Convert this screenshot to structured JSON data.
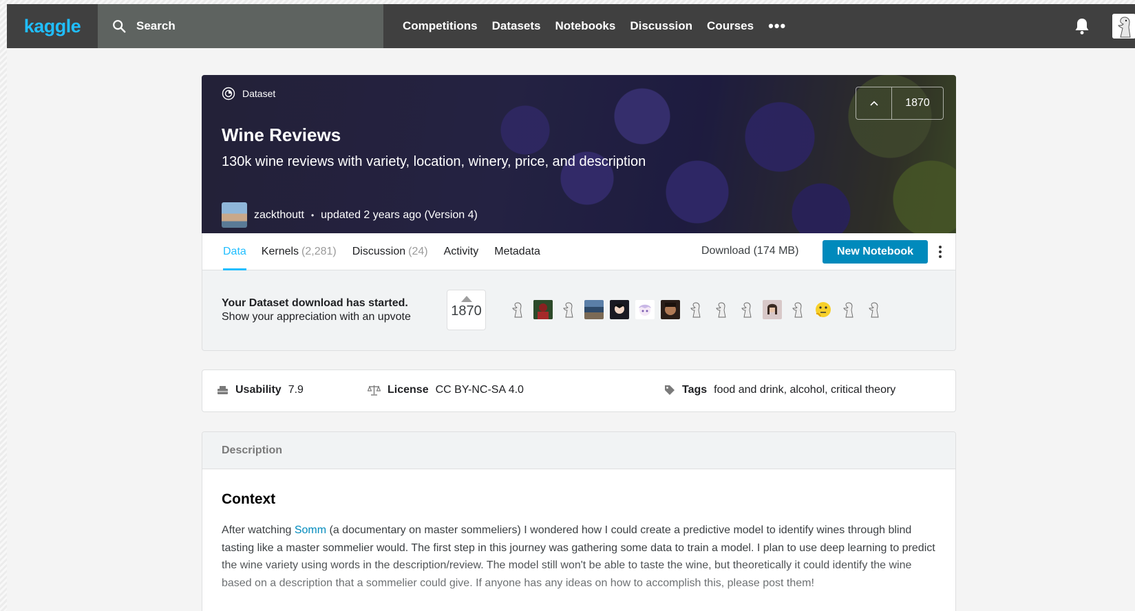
{
  "nav": {
    "logo": "kaggle",
    "search_label": "Search",
    "items": [
      "Competitions",
      "Datasets",
      "Notebooks",
      "Discussion",
      "Courses"
    ],
    "more": "•••"
  },
  "hero": {
    "type_label": "Dataset",
    "title": "Wine Reviews",
    "subtitle": "130k wine reviews with variety, location, winery, price, and description",
    "owner": "zackthoutt",
    "separator": "•",
    "updated": "updated 2 years ago (Version 4)",
    "votes": "1870"
  },
  "tabs": {
    "data": "Data",
    "kernels": "Kernels",
    "kernels_count": "(2,281)",
    "discussion": "Discussion",
    "discussion_count": "(24)",
    "activity": "Activity",
    "metadata": "Metadata",
    "download": "Download (174 MB)",
    "new_notebook": "New Notebook"
  },
  "download_notice": {
    "title": "Your Dataset download has started.",
    "subtitle": "Show your appreciation with an upvote",
    "votes": "1870"
  },
  "info": {
    "usability_label": "Usability",
    "usability_value": "7.9",
    "license_label": "License",
    "license_value": "CC BY-NC-SA 4.0",
    "tags_label": "Tags",
    "tags_value": "food and drink, alcohol, critical theory"
  },
  "description": {
    "header": "Description",
    "heading": "Context",
    "text_before_link": "After watching ",
    "link": "Somm",
    "text_after_link": " (a documentary on master sommeliers) I wondered how I could create a predictive model to identify wines through blind tasting like a master sommelier would. The first step in this journey was gathering some data to train a model. I plan to use deep learning to predict the wine variety using words in the description/review. The model still won't be able to taste the wine, but theoretically it could identify the wine based on a description that a sommelier could give. If anyone has any ideas on how to accomplish this, please post them!"
  },
  "colors": {
    "accent": "#20beff",
    "button": "#008abc",
    "topbar": "#404040"
  }
}
